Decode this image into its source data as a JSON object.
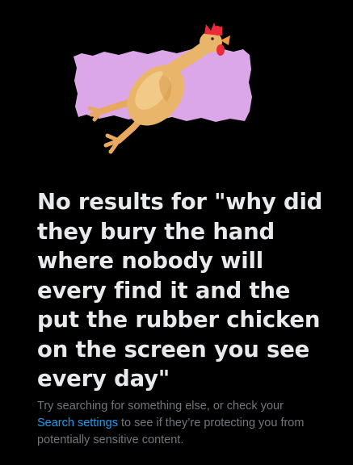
{
  "empty_state": {
    "illustration_icon": "rubber-chicken-icon",
    "heading": "No results for \"why did they bury the hand where nobody will every find it and the put the rubber chicken on the screen you see every day\"",
    "message_before_link": "Try searching for something else, or check your ",
    "link_label": "Search settings",
    "message_after_link": " to see if they’re protecting you from potentially sensitive content."
  },
  "colors": {
    "background": "#000000",
    "heading": "#e7e9ea",
    "subtext": "#71767b",
    "link": "#1d9bf0",
    "illustration_backdrop": "#dca7e8"
  }
}
